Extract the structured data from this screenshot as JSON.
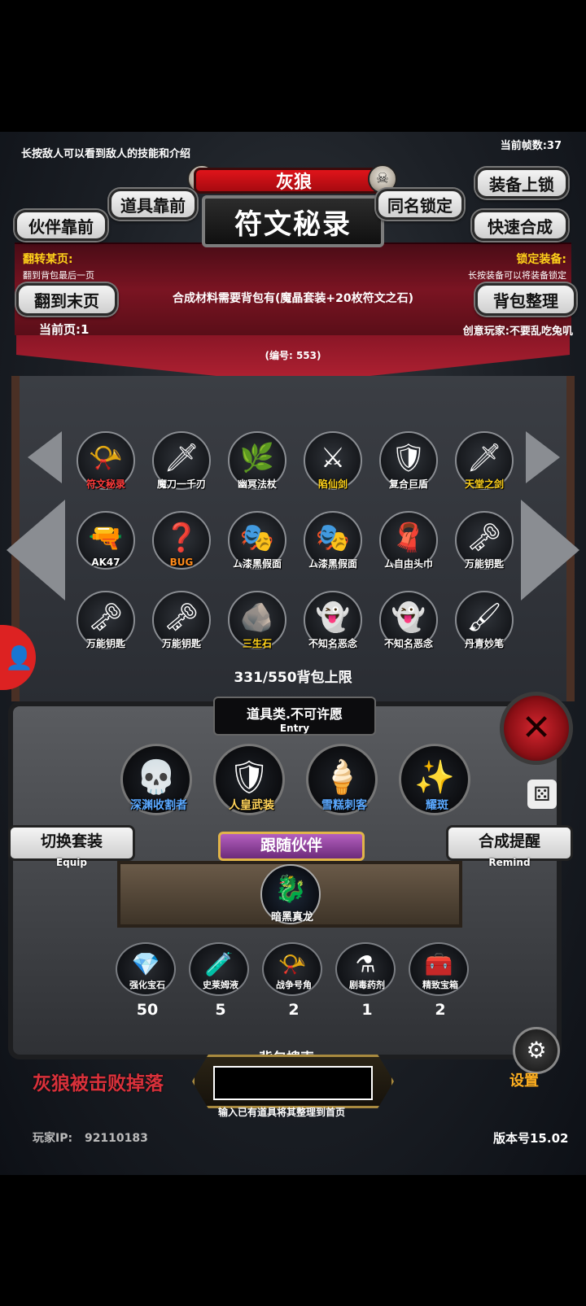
{
  "hud": {
    "tip": "长按敌人可以看到敌人的技能和介绍",
    "fps": "当前帧数:37"
  },
  "header": {
    "enemy_name": "灰狼",
    "title": "符文秘录",
    "btn_item_front": "道具靠前",
    "btn_partner_front": "伙伴靠前",
    "btn_same_lock": "同名锁定",
    "btn_equip_lock": "装备上锁",
    "btn_quick_merge": "快速合成"
  },
  "info_panel": {
    "flip_label": "翻转某页:",
    "flip_desc": "翻到背包最后一页",
    "lock_label": "锁定装备:",
    "lock_desc": "长按装备可以将装备锁定",
    "btn_last_page": "翻到末页",
    "btn_sort": "背包整理",
    "current_page": "当前页:1",
    "creator": "创意玩家:不要乱吃兔叽",
    "requirement": "合成材料需要背包有(魔晶套装+20枚符文之石)",
    "item_number": "(编号:  553)"
  },
  "items": [
    {
      "name": "符文秘录",
      "icon": "horn-icon",
      "glyph": "📯",
      "color": "#ff3b3b"
    },
    {
      "name": "魔刀一千刃",
      "icon": "katana-icon",
      "glyph": "🗡",
      "color": "#ffffff"
    },
    {
      "name": "幽冥法杖",
      "icon": "staff-icon",
      "glyph": "🌿",
      "color": "#ffffff"
    },
    {
      "name": "陷仙剑",
      "icon": "sword-icon",
      "glyph": "⚔",
      "color": "#ffd21a"
    },
    {
      "name": "复合巨盾",
      "icon": "shield-icon",
      "glyph": "🛡",
      "color": "#ffffff"
    },
    {
      "name": "天堂之剑",
      "icon": "holy-sword-icon",
      "glyph": "🗡",
      "color": "#ffd21a"
    },
    {
      "name": "AK47",
      "icon": "rifle-icon",
      "glyph": "🔫",
      "color": "#ffffff"
    },
    {
      "name": "BUG",
      "icon": "bug-icon",
      "glyph": "❓",
      "color": "#ff8a1a"
    },
    {
      "name": "ム漆黑假面",
      "icon": "mask-icon",
      "glyph": "🎭",
      "color": "#ffffff"
    },
    {
      "name": "ム漆黑假面",
      "icon": "mask-icon",
      "glyph": "🎭",
      "color": "#ffffff"
    },
    {
      "name": "ム自由头巾",
      "icon": "bandana-icon",
      "glyph": "🧣",
      "color": "#ffffff"
    },
    {
      "name": "万能钥匙",
      "icon": "key-icon",
      "glyph": "🗝",
      "color": "#ffffff"
    },
    {
      "name": "万能钥匙",
      "icon": "key-icon",
      "glyph": "🗝",
      "color": "#ffffff"
    },
    {
      "name": "万能钥匙",
      "icon": "key-icon",
      "glyph": "🗝",
      "color": "#ffffff"
    },
    {
      "name": "三生石",
      "icon": "stone-icon",
      "glyph": "🪨",
      "color": "#ffd21a"
    },
    {
      "name": "不知名恶念",
      "icon": "ghost-icon",
      "glyph": "👻",
      "color": "#ffffff"
    },
    {
      "name": "不知名恶念",
      "icon": "ghost-icon",
      "glyph": "👻",
      "color": "#ffffff"
    },
    {
      "name": "丹青妙笔",
      "icon": "brush-icon",
      "glyph": "🖌",
      "color": "#ffffff"
    }
  ],
  "capacity": "331/550背包上限",
  "entry": {
    "text": "道具类.不可许愿",
    "sub": "Entry"
  },
  "heroes": [
    {
      "name": "深渊收割者",
      "icon": "reaper-icon",
      "glyph": "💀",
      "color": "#5aa8ff"
    },
    {
      "name": "人皇武装",
      "icon": "armor-icon",
      "glyph": "🛡",
      "color": "#ffd35a"
    },
    {
      "name": "雪糕刺客",
      "icon": "assassin-icon",
      "glyph": "🍦",
      "color": "#5aa8ff"
    },
    {
      "name": "耀斑",
      "icon": "flare-icon",
      "glyph": "✨",
      "color": "#5aa8ff"
    }
  ],
  "equip_btn": {
    "label": "切换套装",
    "sub": "Equip"
  },
  "remind_btn": {
    "label": "合成提醒",
    "sub": "Remind"
  },
  "follow": {
    "label": "跟随伙伴",
    "pet_name": "暗黑真龙"
  },
  "inventory": [
    {
      "name": "强化宝石",
      "icon": "gem-icon",
      "glyph": "💎",
      "count": "50"
    },
    {
      "name": "史莱姆液",
      "icon": "potion-icon",
      "glyph": "🧪",
      "count": "5"
    },
    {
      "name": "战争号角",
      "icon": "war-horn-icon",
      "glyph": "📯",
      "count": "2"
    },
    {
      "name": "剧毒药剂",
      "icon": "poison-icon",
      "glyph": "⚗",
      "count": "1"
    },
    {
      "name": "精致宝箱",
      "icon": "chest-icon",
      "glyph": "🧰",
      "count": "2"
    }
  ],
  "drop_text": "灰狼被击败掉落",
  "search": {
    "label": "背包搜索",
    "hint": "输入已有道具将其整理到首页",
    "placeholder": ""
  },
  "settings_label": "设置",
  "footer": {
    "ip_label": "玩家IP:",
    "ip_value": "92110183",
    "version": "版本号15.02"
  }
}
